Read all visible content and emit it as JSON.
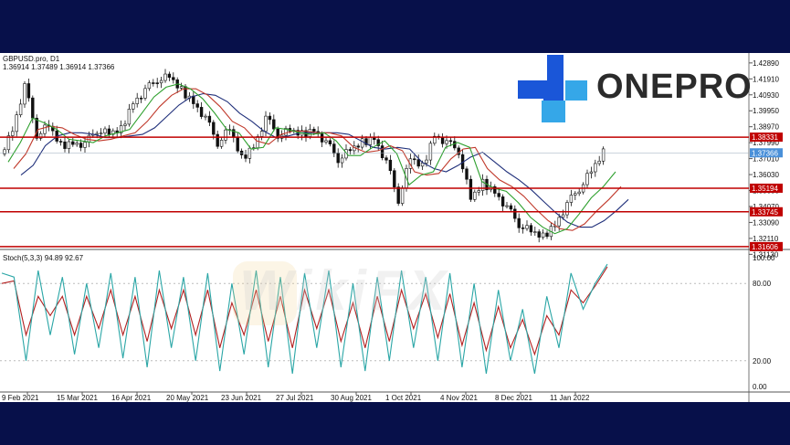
{
  "header": {
    "symbol": "GBPUSD.pro, D1",
    "ohlc": "1.36914 1.37489 1.36914 1.37366",
    "indicator": "Stoch(5,3,3) 94.89 92.67"
  },
  "brand": {
    "text": "ONEPRO",
    "color": "#1a56d8",
    "accent": "#35a7e8"
  },
  "watermark": "WikiFX",
  "chart_data": {
    "type": "candlestick",
    "price_axis": {
      "ylim": [
        1.307,
        1.435
      ],
      "ticks": [
        "1.42890",
        "1.41910",
        "1.40930",
        "1.39950",
        "1.38970",
        "1.37990",
        "1.37010",
        "1.36030",
        "1.35050",
        "1.34070",
        "1.33090",
        "1.32110",
        "1.31130"
      ]
    },
    "stoch_axis": {
      "ylim": [
        0,
        100
      ],
      "ticks": [
        "100.00",
        "80.00",
        "20.00",
        "0.00"
      ]
    },
    "x_labels": [
      "9 Feb 2021",
      "15 Mar 2021",
      "16 Apr 2021",
      "20 May 2021",
      "23 Jun 2021",
      "27 Jul 2021",
      "30 Aug 2021",
      "1 Oct 2021",
      "4 Nov 2021",
      "8 Dec 2021",
      "11 Jan 2022"
    ],
    "horizontal_levels": [
      {
        "value": 1.38331,
        "label": "1.38331",
        "color": "#c00000"
      },
      {
        "value": 1.35194,
        "label": "1.35194",
        "color": "#c00000"
      },
      {
        "value": 1.33745,
        "label": "1.33745",
        "color": "#c00000"
      },
      {
        "value": 1.31606,
        "label": "1.31606",
        "color": "#c00000"
      }
    ],
    "current_price": {
      "value": 1.37366,
      "label": "1.37366",
      "color": "#4a90d9"
    },
    "price_path": [
      1.373,
      1.388,
      1.415,
      1.385,
      1.39,
      1.378,
      1.38,
      1.379,
      1.388,
      1.385,
      1.388,
      1.405,
      1.412,
      1.419,
      1.42,
      1.412,
      1.405,
      1.395,
      1.38,
      1.388,
      1.37,
      1.378,
      1.395,
      1.385,
      1.387,
      1.385,
      1.388,
      1.38,
      1.37,
      1.375,
      1.38,
      1.383,
      1.368,
      1.345,
      1.37,
      1.365,
      1.385,
      1.38,
      1.375,
      1.345,
      1.355,
      1.35,
      1.34,
      1.33,
      1.325,
      1.322,
      1.33,
      1.342,
      1.352,
      1.362,
      1.3737
    ],
    "ma_fast": [
      1.368,
      1.38,
      1.395,
      1.392,
      1.388,
      1.382,
      1.381,
      1.38,
      1.384,
      1.386,
      1.388,
      1.398,
      1.408,
      1.414,
      1.416,
      1.413,
      1.407,
      1.398,
      1.388,
      1.386,
      1.376,
      1.377,
      1.389,
      1.388,
      1.386,
      1.385,
      1.386,
      1.381,
      1.372,
      1.372,
      1.377,
      1.381,
      1.373,
      1.354,
      1.36,
      1.362,
      1.377,
      1.38,
      1.377,
      1.356,
      1.352,
      1.35,
      1.343,
      1.334,
      1.328,
      1.324,
      1.327,
      1.336,
      1.346,
      1.353,
      1.362
    ],
    "ma_mid": [
      1.364,
      1.373,
      1.388,
      1.39,
      1.389,
      1.385,
      1.382,
      1.381,
      1.382,
      1.384,
      1.386,
      1.393,
      1.402,
      1.409,
      1.413,
      1.413,
      1.409,
      1.402,
      1.393,
      1.389,
      1.381,
      1.379,
      1.385,
      1.387,
      1.387,
      1.386,
      1.386,
      1.384,
      1.377,
      1.374,
      1.375,
      1.378,
      1.375,
      1.362,
      1.36,
      1.361,
      1.37,
      1.376,
      1.377,
      1.364,
      1.357,
      1.353,
      1.347,
      1.339,
      1.332,
      1.327,
      1.326,
      1.33,
      1.338,
      1.345,
      1.353
    ],
    "ma_slow": [
      1.36,
      1.366,
      1.378,
      1.384,
      1.386,
      1.386,
      1.385,
      1.383,
      1.383,
      1.384,
      1.385,
      1.389,
      1.396,
      1.403,
      1.408,
      1.41,
      1.409,
      1.405,
      1.398,
      1.393,
      1.387,
      1.383,
      1.384,
      1.386,
      1.386,
      1.386,
      1.386,
      1.385,
      1.381,
      1.377,
      1.376,
      1.377,
      1.376,
      1.368,
      1.364,
      1.362,
      1.366,
      1.371,
      1.374,
      1.368,
      1.362,
      1.357,
      1.351,
      1.344,
      1.337,
      1.331,
      1.328,
      1.328,
      1.332,
      1.338,
      1.345
    ],
    "stoch_main": [
      88,
      85,
      20,
      90,
      40,
      85,
      25,
      80,
      30,
      88,
      22,
      85,
      15,
      90,
      30,
      85,
      20,
      88,
      12,
      80,
      25,
      90,
      15,
      85,
      10,
      88,
      30,
      90,
      15,
      80,
      12,
      85,
      20,
      90,
      30,
      85,
      20,
      88,
      15,
      80,
      10,
      75,
      20,
      60,
      10,
      70,
      30,
      88,
      60,
      80,
      95
    ],
    "stoch_signal": [
      80,
      82,
      40,
      70,
      55,
      70,
      40,
      70,
      45,
      75,
      40,
      70,
      35,
      75,
      45,
      75,
      40,
      75,
      30,
      65,
      40,
      75,
      35,
      70,
      30,
      75,
      45,
      75,
      35,
      65,
      30,
      70,
      35,
      75,
      45,
      72,
      38,
      72,
      32,
      65,
      28,
      62,
      30,
      52,
      25,
      55,
      40,
      75,
      65,
      78,
      93
    ],
    "colors": {
      "ma_fast": "#2ea02e",
      "ma_mid": "#c0392b",
      "ma_slow": "#1f2f7a",
      "stoch_main": "#2aa6a6",
      "stoch_signal": "#b32020",
      "candle": "#111111"
    }
  }
}
